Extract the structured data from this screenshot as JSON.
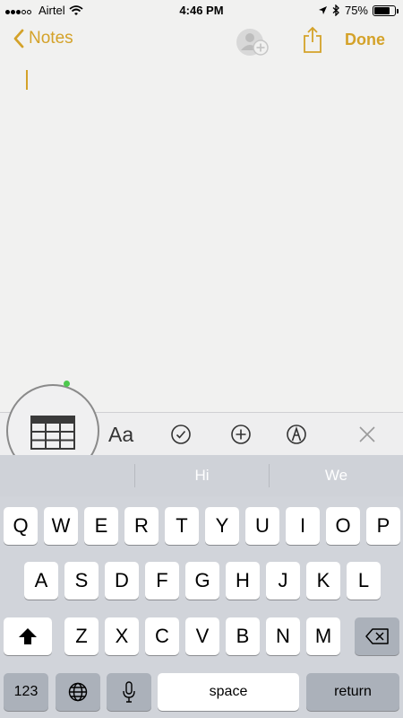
{
  "status_bar": {
    "carrier": "Airtel",
    "time": "4:46 PM",
    "battery": "75%",
    "battery_level": 0.75,
    "icons": [
      "signal-icon",
      "wifi-icon",
      "location-icon",
      "bluetooth-icon",
      "battery-icon"
    ]
  },
  "nav": {
    "back_label": "Notes",
    "done_label": "Done",
    "accent_color": "#d4a229",
    "icons": [
      "chevron-left-icon",
      "add-people-icon",
      "share-icon"
    ]
  },
  "toolbar": {
    "text_style_label": "Aa",
    "icons": [
      "table-icon",
      "checklist-icon",
      "add-icon",
      "markup-icon",
      "close-icon"
    ]
  },
  "suggestions": [
    "",
    "Hi",
    "We"
  ],
  "keyboard": {
    "row1": [
      "Q",
      "W",
      "E",
      "R",
      "T",
      "Y",
      "U",
      "I",
      "O",
      "P"
    ],
    "row2": [
      "A",
      "S",
      "D",
      "F",
      "G",
      "H",
      "J",
      "K",
      "L"
    ],
    "row3": [
      "Z",
      "X",
      "C",
      "V",
      "B",
      "N",
      "M"
    ],
    "numbers_label": "123",
    "space_label": "space",
    "return_label": "return",
    "icons": [
      "shift-icon",
      "backspace-icon",
      "globe-icon",
      "microphone-icon"
    ]
  }
}
